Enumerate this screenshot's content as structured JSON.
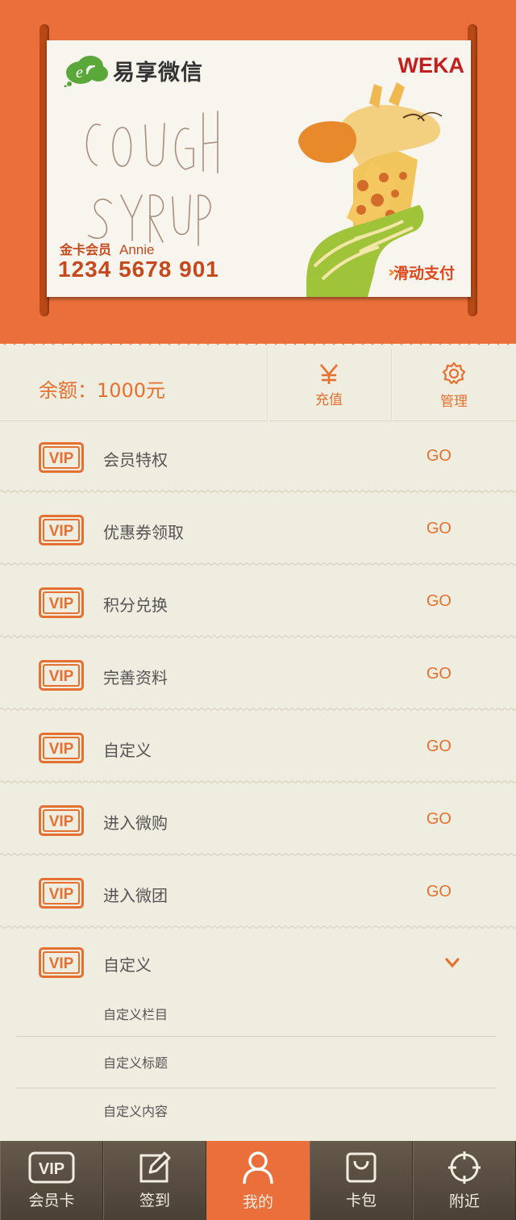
{
  "card": {
    "app_name": "易享微信",
    "brand": "WEKA",
    "artwork_lines": [
      "COUGH",
      "SYRUP"
    ],
    "member_level": "金卡会员",
    "member_name": "Annie",
    "card_number": "1234 5678 901",
    "slide_pay": "滑动支付",
    "slide_arrows": "››"
  },
  "balance": {
    "text": "余额：1000元",
    "recharge_label": "充值",
    "manage_label": "管理"
  },
  "menu": {
    "go_label": "GO",
    "vip_label": "VIP",
    "items": [
      {
        "label": "会员特权"
      },
      {
        "label": "优惠券领取"
      },
      {
        "label": "积分兑换"
      },
      {
        "label": "完善资料"
      },
      {
        "label": "自定义"
      },
      {
        "label": "进入微购"
      },
      {
        "label": "进入微团"
      }
    ],
    "expanded": {
      "label": "自定义",
      "sub_items": [
        "自定义栏目",
        "自定义标题",
        "自定义内容"
      ]
    }
  },
  "tabbar": {
    "tabs": [
      {
        "label": "会员卡",
        "icon": "vip-icon"
      },
      {
        "label": "签到",
        "icon": "edit-icon"
      },
      {
        "label": "我的",
        "icon": "user-icon"
      },
      {
        "label": "卡包",
        "icon": "bag-icon"
      },
      {
        "label": "附近",
        "icon": "location-crosshair-icon"
      }
    ],
    "active_index": 2
  },
  "colors": {
    "accent": "#ea6f3a",
    "card_text": "#c5491c",
    "brand_red": "#c2201f",
    "background": "#efece0",
    "tabbar": "#554a3d"
  }
}
